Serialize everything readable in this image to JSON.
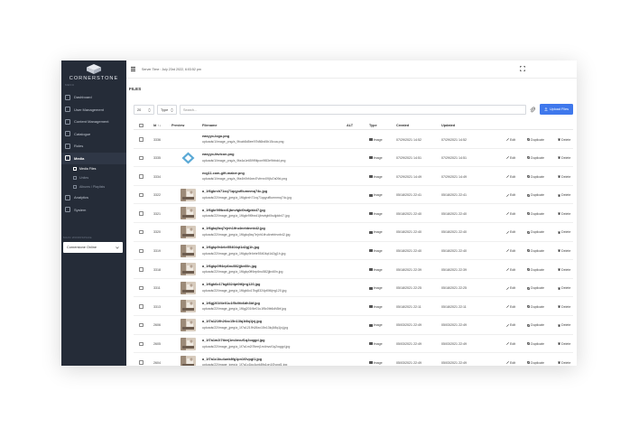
{
  "sidebar": {
    "brand": "CORNERSTONE",
    "menu_caption": "MENU",
    "items": [
      {
        "label": "Dashboard",
        "active": false
      },
      {
        "label": "User Management",
        "active": false
      },
      {
        "label": "Content Management",
        "active": false
      },
      {
        "label": "Catalogue",
        "active": false
      },
      {
        "label": "Roles",
        "active": false
      },
      {
        "label": "Media",
        "active": true
      }
    ],
    "media_sub": [
      {
        "label": "Media Files",
        "active": true
      },
      {
        "label": "Unites",
        "active": false
      },
      {
        "label": "Albums / Playlists",
        "active": false
      }
    ],
    "items_after": [
      {
        "label": "Analytics"
      },
      {
        "label": "System"
      }
    ],
    "workspace_caption": "MAIN WORKSPACE",
    "workspace_value": "Cornerstone Online"
  },
  "topbar": {
    "server_time": "Server Time : July 23rd 2022, 6:03:52 pm"
  },
  "page": {
    "title": "FILES"
  },
  "toolbar": {
    "count_value": "20",
    "type_value": "Type",
    "search_placeholder": "Search...",
    "upload_label": "Upload Files"
  },
  "table": {
    "headers": {
      "id": "Id ↑↓",
      "preview": "Preview",
      "filename": "Filename",
      "alt": "ALT",
      "type": "Type",
      "created": "Created",
      "updated": "Updated"
    },
    "actions": {
      "edit": "Edit",
      "duplicate": "Duplicate",
      "delete": "Delete"
    },
    "rows": [
      {
        "id": "3336",
        "filename": "easyyo-logo.png",
        "path": "uploads/1/image_png/a_9fcab8d5ee97b86bd5b15cua.png",
        "type": "Image",
        "created": "07/29/2021 14:52",
        "updated": "07/29/2021 14:52",
        "thumb": "none"
      },
      {
        "id": "3335",
        "filename": "easyyo-favicon.png",
        "path": "uploads/1/image_png/a_9fa4a1e659f9iipon9f83e9bbdd.png",
        "type": "Image",
        "created": "07/29/2021 14:51",
        "updated": "07/29/2021 14:51",
        "thumb": "diamond"
      },
      {
        "id": "3334",
        "filename": "ecg11.com-gift-maker.png",
        "path": "uploads/1/image_png/a_9fa4ir0hf4xed7vfrrxx09jfu7a09d.png",
        "type": "Image",
        "created": "07/29/2021 14:49",
        "updated": "07/29/2021 14:49",
        "thumb": "none"
      },
      {
        "id": "3322",
        "filename": "a_1f6gkrxh71xq71qqyufllumnmq74c.jpg",
        "path": "uploads/22/image_jpeg/a_1f6gkrxh71xq71qqyufllumnmq74c.jpg",
        "type": "Image",
        "created": "05/18/2021 22:41",
        "updated": "05/18/2021 22:41",
        "thumb": "photo"
      },
      {
        "id": "3321",
        "filename": "a_1f6gkr9l9bxd1jbnvtgbl0sdjpkb47.jpg",
        "path": "uploads/22/image_jpeg/a_1f6gkr9l9bxd1jbnvtgbl0sdjpkb47.jpg",
        "type": "Image",
        "created": "05/18/2021 22:40",
        "updated": "05/18/2021 22:40",
        "thumb": "photo"
      },
      {
        "id": "3320",
        "filename": "a_1f6gkq9zq7ejnh1ifru4nebbvnb42.jpg",
        "path": "uploads/22/image_jpeg/a_1f6gkq9zq7ejnh1ifru4nebbvnb42.jpg",
        "type": "Image",
        "created": "05/18/2021 22:40",
        "updated": "05/18/2021 22:40",
        "thumb": "photo"
      },
      {
        "id": "3319",
        "filename": "a_1f6gkp9r4ebr55404qt1d2gj1h.jpg",
        "path": "uploads/22/image_jpeg/a_1f6gkp9r4ebr55404qt1d2gj1h.jpg",
        "type": "Image",
        "created": "05/18/2021 22:40",
        "updated": "05/18/2021 22:40",
        "thumb": "photo"
      },
      {
        "id": "3318",
        "filename": "a_1f6gkp0ff4ep6nu582jjkv60n.jpg",
        "path": "uploads/22/image_jpeg/a_1f6gkp0ff4ep6nu582jjkv60n.jpg",
        "type": "Image",
        "created": "05/18/2021 22:39",
        "updated": "05/18/2021 22:39",
        "thumb": "photo"
      },
      {
        "id": "3311",
        "filename": "a_1f6gk6o17bg8324pt0t6jrrg120.jpg",
        "path": "uploads/22/image_jpeg/a_1f6gk6o17bg8324pt0t6jrrg120.jpg",
        "type": "Image",
        "created": "05/18/2021 22:25",
        "updated": "05/18/2021 22:25",
        "thumb": "photo"
      },
      {
        "id": "3313",
        "filename": "a_1f6gj201f4e01u1f5c0tb6dh3bf.jpg",
        "path": "uploads/22/image_jpeg/a_1f6gj201f4e01u1f5c0tb6dh3bf.jpg",
        "type": "Image",
        "created": "05/18/2021 22:11",
        "updated": "05/18/2021 22:11",
        "thumb": "photo"
      },
      {
        "id": "2606",
        "filename": "a_1f7a1219h26xc15n13lq1t8q1jxj.jpg",
        "path": "uploads/22/image_jpeg/a_1f7a1219h26xc15n13lq1t8q1jxj.jpg",
        "type": "Image",
        "created": "05/03/2021 22:49",
        "updated": "05/03/2021 22:49",
        "thumb": "photo"
      },
      {
        "id": "2605",
        "filename": "a_1f7a1m2i7tieej1m4nvuf1q2oqgpl.jpg",
        "path": "uploads/22/image_jpeg/a_1f7a1m2i7tieej1m4nvuf1q2oqgpl.jpg",
        "type": "Image",
        "created": "05/03/2021 22:49",
        "updated": "05/03/2021 22:49",
        "thumb": "photo"
      },
      {
        "id": "2604",
        "filename": "a_1f7a1c1ku4unk8fg1pn1f2vpgl1.jpg",
        "path": "uploads/22/image_jpeg/a_1f7a1c1ku4unk8fg1pn1f2vpgl1.jpg",
        "type": "Image",
        "created": "05/03/2021 22:49",
        "updated": "05/03/2021 22:49",
        "thumb": "photo"
      }
    ]
  },
  "colors": {
    "sidebar_bg": "#252c38",
    "accent": "#3f78ec"
  }
}
